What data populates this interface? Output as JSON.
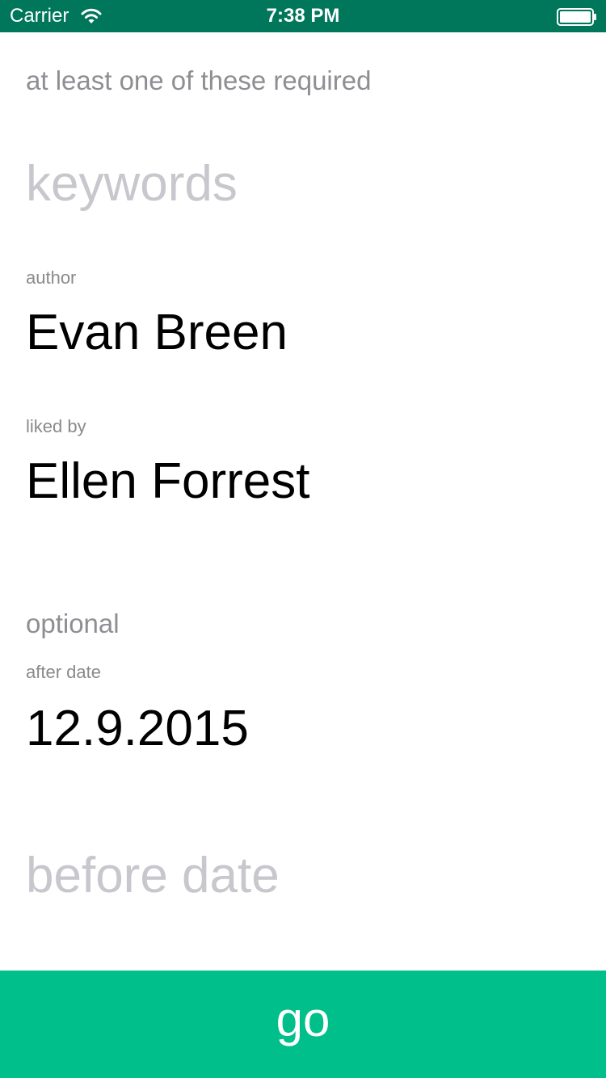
{
  "status_bar": {
    "carrier": "Carrier",
    "time": "7:38 PM",
    "background": "#00765a",
    "icons": [
      "wifi-icon",
      "battery-icon"
    ]
  },
  "form": {
    "required_note": "at least one of these required",
    "keywords": {
      "placeholder": "keywords",
      "value": ""
    },
    "author": {
      "label": "author",
      "value": "Evan Breen"
    },
    "liked_by": {
      "label": "liked by",
      "value": "Ellen Forrest"
    },
    "optional_note": "optional",
    "after_date": {
      "label": "after date",
      "value": "12.9.2015"
    },
    "before_date": {
      "placeholder": "before date",
      "value": ""
    }
  },
  "go_button": {
    "label": "go",
    "color": "#00bf8b"
  }
}
